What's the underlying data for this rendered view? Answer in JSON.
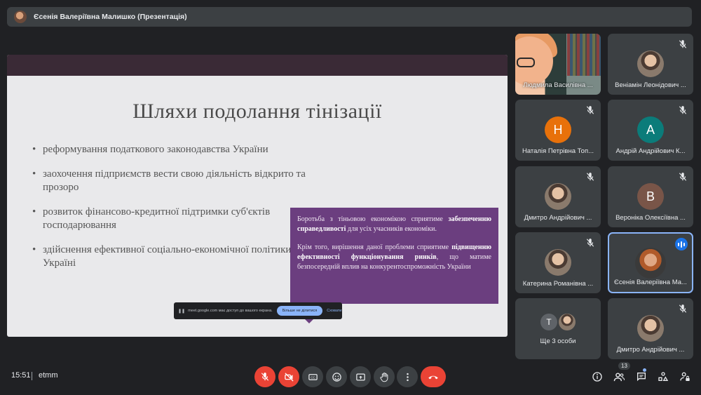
{
  "presenter": {
    "title": "Єсенія Валеріївна Малишко (Презентація)"
  },
  "slide": {
    "title": "Шляхи подолання тінізації",
    "bullets": [
      "реформування податкового законодавства України",
      "заохочення підприємств вести свою діяльність відкрито та прозоро",
      "розвиток фінансово-кредитної підтримки суб'єктів господарювання",
      "здійснення ефективної соціально-економічної політики в Україні"
    ],
    "box": {
      "p1_start": "Боротьба з тіньовою економікою сприятиме ",
      "p1_bold": "забезпеченню справедливості",
      "p1_end": " для усіх учасників економіки.",
      "p2_start": "Крім того, вирішення даної проблеми сприятиме ",
      "p2_bold": "підвищенню ефективності функціонування ринків",
      "p2_end": ", що матиме безпосередній вплив на конкурентоспроможність України"
    }
  },
  "share_bar": {
    "text": "meet.google.com має доступ до вашого екрана.",
    "stop": "Більше не ділитися",
    "hide": "Сховати"
  },
  "participants": [
    {
      "name": "Людмила Василівна ...",
      "type": "camera"
    },
    {
      "name": "Веніамін Леонідович ...",
      "type": "photo",
      "muted": true
    },
    {
      "name": "Наталія Петрівна Топ...",
      "initial": "Н",
      "color": "#e8710a",
      "muted": true
    },
    {
      "name": "Андрій Андрійович К...",
      "initial": "А",
      "color": "#0b7c7a",
      "muted": true
    },
    {
      "name": "Дмитро Андрійович ...",
      "type": "photo",
      "muted": true
    },
    {
      "name": "Вероніка Олексіївна ...",
      "initial": "В",
      "color": "#795548",
      "muted": true
    },
    {
      "name": "Катерина Романівна ...",
      "type": "photo",
      "muted": true
    },
    {
      "name": "Єсенія Валеріївна Ма...",
      "type": "photo",
      "speaking": true
    },
    {
      "name": "Ще 3 особи",
      "initials": [
        "Т"
      ]
    },
    {
      "name": "Дмитро Андрійович ...",
      "type": "photo",
      "muted": true
    }
  ],
  "bottom": {
    "time": "15:51",
    "code": "etmm",
    "people_count": "13"
  },
  "colors": {
    "end_call": "#ea4335",
    "accent": "#8ab4f8",
    "slide_box": "#6b3e7f"
  }
}
